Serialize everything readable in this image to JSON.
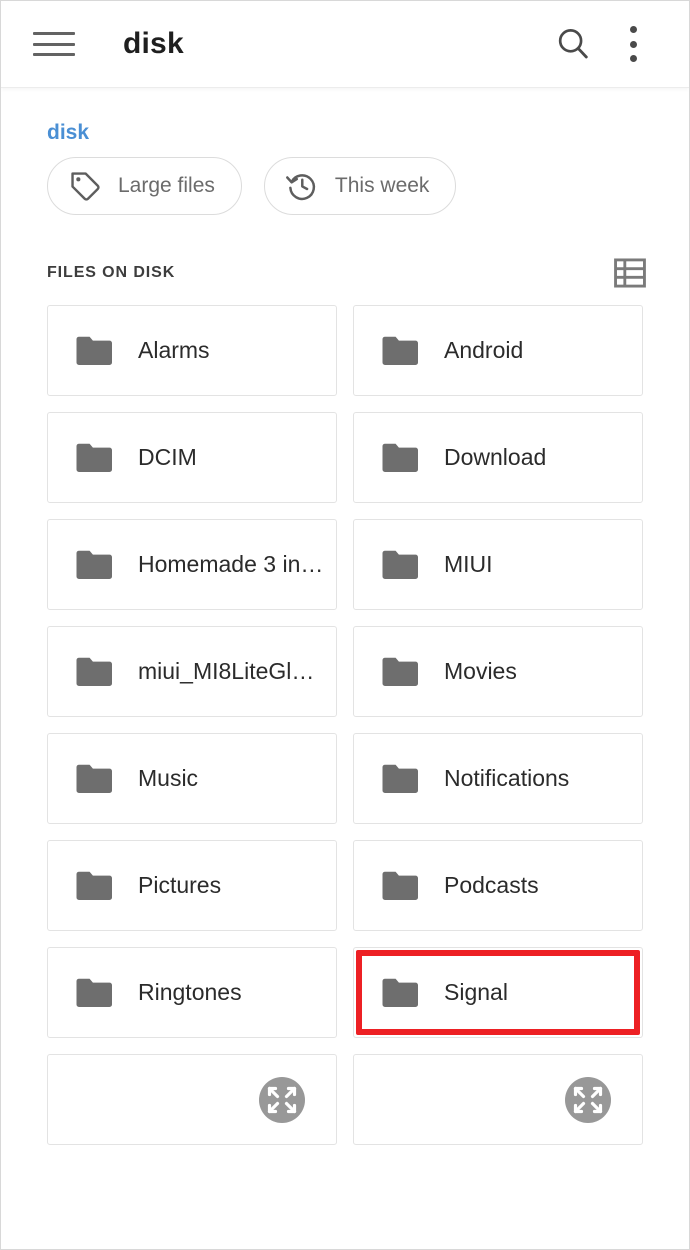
{
  "app": {
    "title": "disk",
    "menu_icon": "hamburger-menu-icon",
    "search_icon": "search-icon",
    "overflow_icon": "more-vertical-icon"
  },
  "breadcrumb": {
    "current": "disk"
  },
  "filters": [
    {
      "label": "Large files",
      "icon": "tag-icon"
    },
    {
      "label": "This week",
      "icon": "history-clock-icon"
    }
  ],
  "section": {
    "title": "FILES ON DISK",
    "view_toggle_icon": "list-view-icon"
  },
  "folders": [
    {
      "name": "Alarms",
      "icon": "folder-icon",
      "highlighted": false
    },
    {
      "name": "Android",
      "icon": "folder-icon",
      "highlighted": false
    },
    {
      "name": "DCIM",
      "icon": "folder-icon",
      "highlighted": false
    },
    {
      "name": "Download",
      "icon": "folder-icon",
      "highlighted": false
    },
    {
      "name": "Homemade 3 in…",
      "icon": "folder-icon",
      "highlighted": false
    },
    {
      "name": "MIUI",
      "icon": "folder-icon",
      "highlighted": false
    },
    {
      "name": "miui_MI8LiteGl…",
      "icon": "folder-icon",
      "highlighted": false
    },
    {
      "name": "Movies",
      "icon": "folder-icon",
      "highlighted": false
    },
    {
      "name": "Music",
      "icon": "folder-icon",
      "highlighted": false
    },
    {
      "name": "Notifications",
      "icon": "folder-icon",
      "highlighted": false
    },
    {
      "name": "Pictures",
      "icon": "folder-icon",
      "highlighted": false
    },
    {
      "name": "Podcasts",
      "icon": "folder-icon",
      "highlighted": false
    },
    {
      "name": "Ringtones",
      "icon": "folder-icon",
      "highlighted": false
    },
    {
      "name": "Signal",
      "icon": "folder-icon",
      "highlighted": true
    }
  ],
  "partial_row": [
    {
      "icon": "expand-arrows-icon"
    },
    {
      "icon": "expand-arrows-icon"
    }
  ],
  "colors": {
    "accent_blue": "#4a8fd4",
    "highlight_red": "#ed2024",
    "folder_gray": "#6e6e6e",
    "text_dark": "#2b2b2b",
    "chip_text": "#6b6b6b",
    "border": "#e3e3e3",
    "background": "#ffffff"
  }
}
